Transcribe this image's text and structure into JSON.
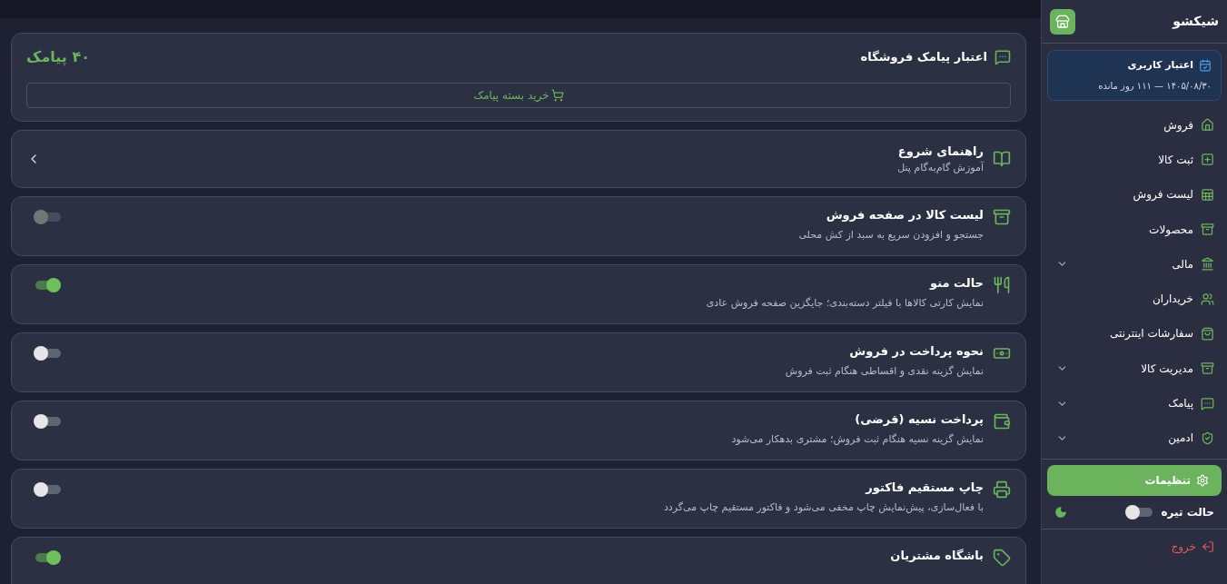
{
  "sidebar": {
    "brand": "شیکشو",
    "credit": {
      "title": "اعتبار کاربری",
      "detail": "۱۴۰۵/۰۸/۳۰ — ۱۱۱ روز مانده"
    },
    "items": [
      {
        "label": "فروش",
        "kind": "link"
      },
      {
        "label": "ثبت کالا",
        "kind": "link"
      },
      {
        "label": "لیست فروش",
        "kind": "link"
      },
      {
        "label": "محصولات",
        "kind": "link"
      },
      {
        "label": "مالی",
        "kind": "group"
      },
      {
        "label": "خریداران",
        "kind": "link"
      },
      {
        "label": "سفارشات اینترنتی",
        "kind": "link"
      },
      {
        "label": "مدیریت کالا",
        "kind": "group"
      },
      {
        "label": "پیامک",
        "kind": "group"
      },
      {
        "label": "ادمین",
        "kind": "group"
      }
    ],
    "settings_button": {
      "label": "تنظیمات",
      "selected": true
    },
    "dark_mode": {
      "label": "حالت تیره",
      "on": false
    },
    "logout": "خروج"
  },
  "main": {
    "sms_credit": {
      "title": "اعتبار پیامک فروشگاه",
      "amount": "۴۰ پیامک",
      "buy_button": "خرید بسته پیامک"
    },
    "guide": {
      "title": "راهنمای شروع",
      "subtitle": "آموزش گام‌به‌گام پنل"
    },
    "settings": [
      {
        "title": "لیست کالا در صفحه فروش",
        "description": "جستجو و افزودن سریع به سبد از کش محلی",
        "on": false,
        "disabled": true
      },
      {
        "title": "حالت منو",
        "description": "نمایش کارتی کالاها با فیلتر دسته‌بندی؛ جایگزین صفحه فروش عادی",
        "on": true,
        "disabled": false
      },
      {
        "title": "نحوه پرداخت در فروش",
        "description": "نمایش گزینه نقدی و اقساطی هنگام ثبت فروش",
        "on": false,
        "disabled": false
      },
      {
        "title": "پرداخت نسیه (قرضی)",
        "description": "نمایش گزینه نسیه هنگام ثبت فروش؛ مشتری بدهکار می‌شود",
        "on": false,
        "disabled": false
      },
      {
        "title": "چاپ مستقیم فاکتور",
        "description": "با فعال‌سازی، پیش‌نمایش چاپ مخفی می‌شود و فاکتور مستقیم چاپ می‌گردد",
        "on": false,
        "disabled": false
      },
      {
        "title": "باشگاه مشتریان",
        "on": true,
        "disabled": false
      }
    ]
  }
}
